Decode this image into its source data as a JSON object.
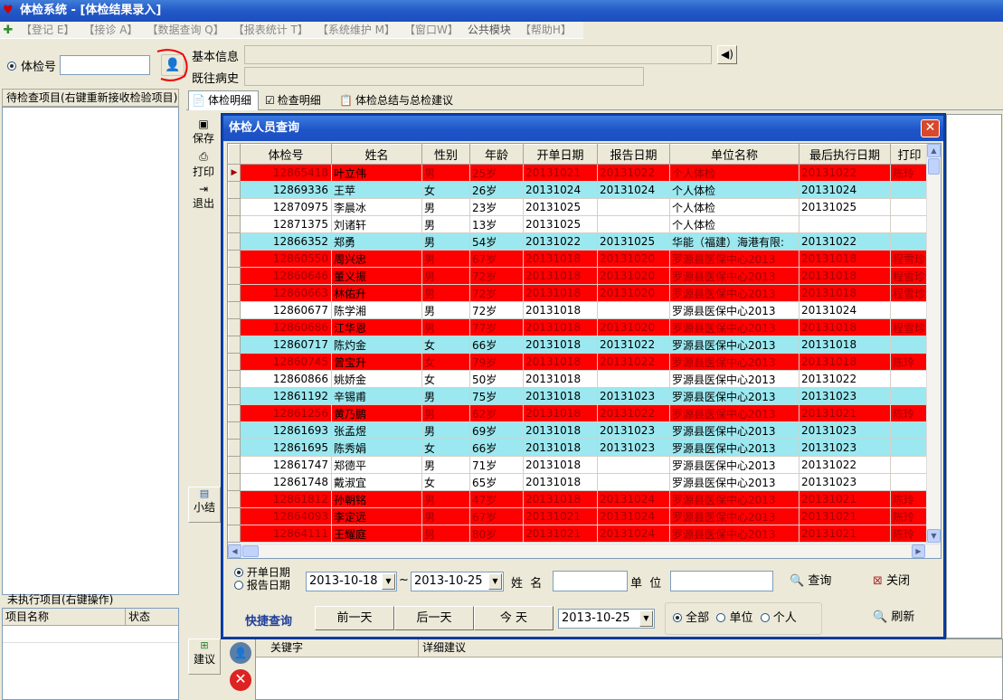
{
  "window": {
    "title": "体检系统 - [体检结果录入]"
  },
  "menu": [
    "【登记 E】",
    "【接诊 A】",
    "【数据查询 Q】",
    "【报表统计 T】",
    "【系统维护 M】",
    "【窗口W】",
    "公共模块",
    "【帮助H】"
  ],
  "left": {
    "exam_no_label": "体检号",
    "exam_no_value": "",
    "pending_header": "待检查项目(右键重新接收检验项目)",
    "unexecuted_header": "未执行项目(右键操作)",
    "col_item": "项目名称",
    "col_status": "状态"
  },
  "info": {
    "basic_label": "基本信息",
    "history_label": "既往病史"
  },
  "tabs": [
    "体检明细",
    "检查明细",
    "体检总结与总检建议"
  ],
  "side_buttons": {
    "save": "保存",
    "print": "打印",
    "exit": "退出",
    "summary": "小结",
    "advice": "建议"
  },
  "bottom": {
    "col_keyword": "关键字",
    "col_detail": "详细建议"
  },
  "dialog": {
    "title": "体检人员查询",
    "columns": [
      "体检号",
      "姓名",
      "性别",
      "年龄",
      "开单日期",
      "报告日期",
      "单位名称",
      "最后执行日期",
      "打印"
    ],
    "rows": [
      {
        "c": "red",
        "v": [
          "12865418",
          "叶立伟",
          "男",
          "25岁",
          "20131021",
          "20131022",
          "个人体检",
          "20131022",
          "陈玲"
        ]
      },
      {
        "c": "cyan",
        "v": [
          "12869336",
          "王苹",
          "女",
          "26岁",
          "20131024",
          "20131024",
          "个人体检",
          "20131024",
          ""
        ]
      },
      {
        "c": "white",
        "v": [
          "12870975",
          "李晨冰",
          "男",
          "23岁",
          "20131025",
          "",
          "个人体检",
          "20131025",
          ""
        ]
      },
      {
        "c": "white",
        "v": [
          "12871375",
          "刘诸轩",
          "男",
          "13岁",
          "20131025",
          "",
          "个人体检",
          "",
          ""
        ]
      },
      {
        "c": "cyan",
        "v": [
          "12866352",
          "郑勇",
          "男",
          "54岁",
          "20131022",
          "20131025",
          "华能（福建）海港有限:",
          "20131022",
          ""
        ]
      },
      {
        "c": "red",
        "v": [
          "12860550",
          "周兴忠",
          "男",
          "67岁",
          "20131018",
          "20131020",
          "罗源县医保中心2013",
          "20131018",
          "程雪珍"
        ]
      },
      {
        "c": "red",
        "v": [
          "12860646",
          "董义振",
          "男",
          "72岁",
          "20131018",
          "20131020",
          "罗源县医保中心2013",
          "20131018",
          "程雪珍"
        ]
      },
      {
        "c": "red",
        "v": [
          "12860663",
          "林佑升",
          "男",
          "72岁",
          "20131018",
          "20131020",
          "罗源县医保中心2013",
          "20131018",
          "程雪珍"
        ]
      },
      {
        "c": "white",
        "v": [
          "12860677",
          "陈学湘",
          "男",
          "72岁",
          "20131018",
          "",
          "罗源县医保中心2013",
          "20131024",
          ""
        ]
      },
      {
        "c": "red",
        "v": [
          "12860686",
          "江华恩",
          "男",
          "77岁",
          "20131018",
          "20131020",
          "罗源县医保中心2013",
          "20131018",
          "程雪珍"
        ]
      },
      {
        "c": "cyan",
        "v": [
          "12860717",
          "陈灼金",
          "女",
          "66岁",
          "20131018",
          "20131022",
          "罗源县医保中心2013",
          "20131018",
          ""
        ]
      },
      {
        "c": "red",
        "v": [
          "12860745",
          "曾宝升",
          "女",
          "79岁",
          "20131018",
          "20131022",
          "罗源县医保中心2013",
          "20131018",
          "陈玲"
        ]
      },
      {
        "c": "white",
        "v": [
          "12860866",
          "姚娇金",
          "女",
          "50岁",
          "20131018",
          "",
          "罗源县医保中心2013",
          "20131022",
          ""
        ]
      },
      {
        "c": "cyan",
        "v": [
          "12861192",
          "辛锡甫",
          "男",
          "75岁",
          "20131018",
          "20131023",
          "罗源县医保中心2013",
          "20131023",
          ""
        ]
      },
      {
        "c": "red",
        "v": [
          "12861256",
          "黄乃鹏",
          "男",
          "62岁",
          "20131018",
          "20131022",
          "罗源县医保中心2013",
          "20131021",
          "陈玲"
        ]
      },
      {
        "c": "cyan",
        "v": [
          "12861693",
          "张孟煜",
          "男",
          "69岁",
          "20131018",
          "20131023",
          "罗源县医保中心2013",
          "20131023",
          ""
        ]
      },
      {
        "c": "cyan",
        "v": [
          "12861695",
          "陈秀娟",
          "女",
          "66岁",
          "20131018",
          "20131023",
          "罗源县医保中心2013",
          "20131023",
          ""
        ]
      },
      {
        "c": "white",
        "v": [
          "12861747",
          "郑德平",
          "男",
          "71岁",
          "20131018",
          "",
          "罗源县医保中心2013",
          "20131022",
          ""
        ]
      },
      {
        "c": "white",
        "v": [
          "12861748",
          "戴淑宜",
          "女",
          "65岁",
          "20131018",
          "",
          "罗源县医保中心2013",
          "20131023",
          ""
        ]
      },
      {
        "c": "red",
        "v": [
          "12861812",
          "孙朝铭",
          "男",
          "47岁",
          "20131018",
          "20131024",
          "罗源县医保中心2013",
          "20131021",
          "陈玲"
        ]
      },
      {
        "c": "red",
        "v": [
          "12864093",
          "李定远",
          "男",
          "67岁",
          "20131021",
          "20131024",
          "罗源县医保中心2013",
          "20131021",
          "陈玲"
        ]
      },
      {
        "c": "red",
        "v": [
          "12864111",
          "王耀庭",
          "男",
          "80岁",
          "20131021",
          "20131024",
          "罗源县医保中心2013",
          "20131021",
          "陈玲"
        ]
      }
    ],
    "radio_open": "开单日期",
    "radio_report": "报告日期",
    "date_from": "2013-10-18",
    "tilde": "~",
    "date_to": "2013-10-25",
    "name_label": "姓  名",
    "unit_label": "单  位",
    "search": "查询",
    "close": "关闭",
    "quick": "快捷查询",
    "prev_day": "前一天",
    "next_day": "后一天",
    "today": "今 天",
    "quick_date": "2013-10-25",
    "all": "全部",
    "by_unit": "单位",
    "personal": "个人",
    "refresh": "刷新"
  },
  "colors": {
    "red_row": "#ff0000",
    "cyan_row": "#9be8f0",
    "title_blue": "#1f55c8"
  }
}
